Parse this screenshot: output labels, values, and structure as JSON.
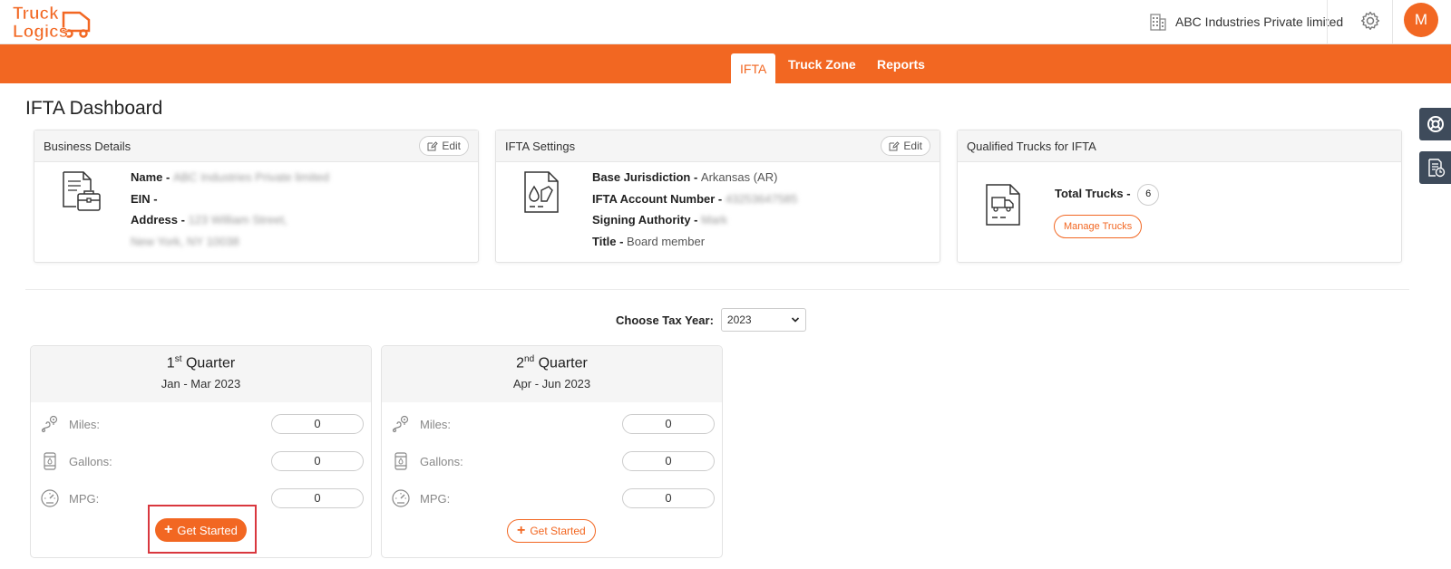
{
  "header": {
    "logo_line1": "Truck",
    "logo_line2": "Logics",
    "company_name": "ABC Industries Private limited",
    "avatar_initial": "M"
  },
  "nav": {
    "tabs": [
      {
        "label": "IFTA",
        "active": true
      },
      {
        "label": "Truck Zone",
        "active": false
      },
      {
        "label": "Reports",
        "active": false
      }
    ]
  },
  "page": {
    "title": "IFTA Dashboard"
  },
  "business": {
    "title": "Business Details",
    "edit_label": "Edit",
    "name_label": "Name - ",
    "name_value": "ABC Industries Private limited",
    "ein_label": "EIN - ",
    "address_label": "Address - ",
    "address_line1": "123 William Street,",
    "address_line2": "New York, NY 10038"
  },
  "ifta_settings": {
    "title": "IFTA Settings",
    "edit_label": "Edit",
    "base_label": "Base Jurisdiction - ",
    "base_value": "Arkansas (AR)",
    "account_label": "IFTA Account Number - ",
    "account_value": "43253647585",
    "signing_label": "Signing Authority - ",
    "signing_value": "Mark",
    "title_label": "Title - ",
    "title_value": "Board member"
  },
  "qualified": {
    "title": "Qualified Trucks for IFTA",
    "total_label": "Total Trucks - ",
    "total_value": "6",
    "manage_label": "Manage Trucks"
  },
  "tax_year": {
    "label": "Choose Tax Year:",
    "selected": "2023"
  },
  "quarters": [
    {
      "ordinal": "1",
      "suffix": "st",
      "title": "Quarter",
      "range": "Jan - Mar 2023",
      "miles_label": "Miles:",
      "miles_value": "0",
      "gallons_label": "Gallons:",
      "gallons_value": "0",
      "mpg_label": "MPG:",
      "mpg_value": "0",
      "button_label": "Get Started"
    },
    {
      "ordinal": "2",
      "suffix": "nd",
      "title": "Quarter",
      "range": "Apr - Jun 2023",
      "miles_label": "Miles:",
      "miles_value": "0",
      "gallons_label": "Gallons:",
      "gallons_value": "0",
      "mpg_label": "MPG:",
      "mpg_value": "0",
      "button_label": "Get Started"
    }
  ],
  "colors": {
    "brand_orange": "#f26722",
    "highlight_red": "#d9373e",
    "side_tab": "#3e4b5b"
  }
}
